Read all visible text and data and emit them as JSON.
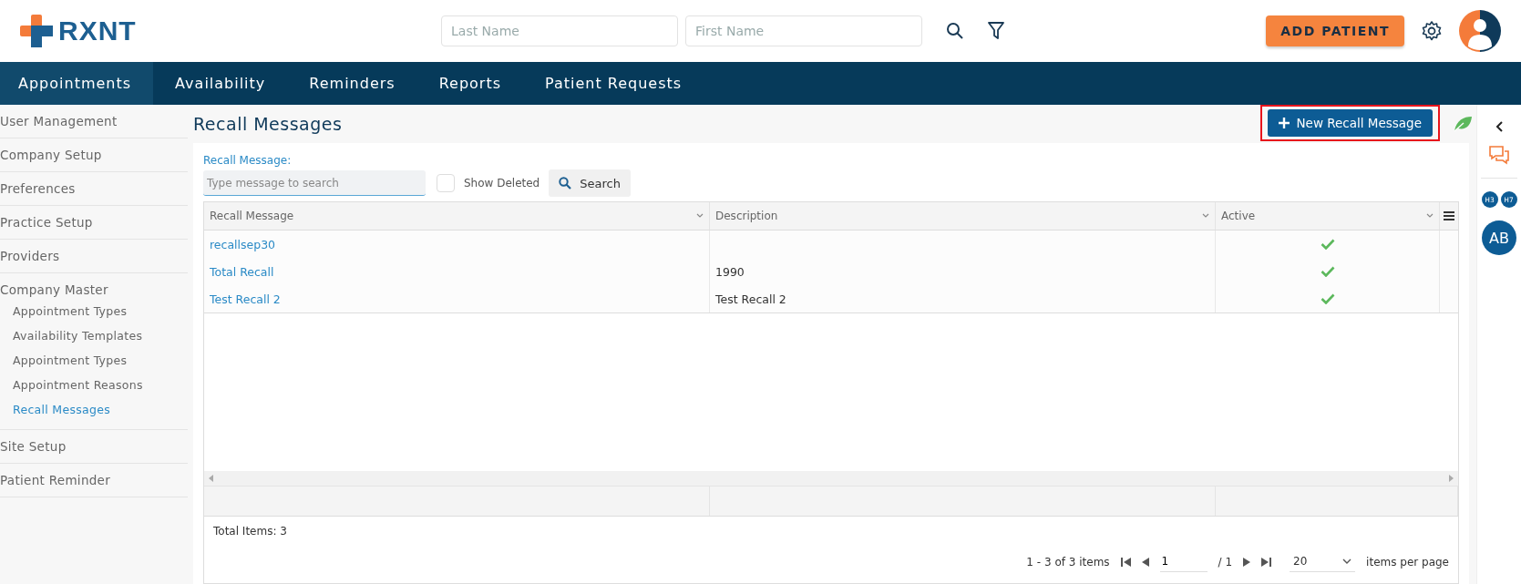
{
  "header": {
    "logo_text": "RXNT",
    "last_name": {
      "placeholder": "Last Name"
    },
    "first_name": {
      "placeholder": "First Name"
    },
    "add_patient": "ADD PATIENT"
  },
  "nav": [
    {
      "label": "Appointments",
      "selected": true
    },
    {
      "label": "Availability",
      "selected": false
    },
    {
      "label": "Reminders",
      "selected": false
    },
    {
      "label": "Reports",
      "selected": false
    },
    {
      "label": "Patient Requests",
      "selected": false
    }
  ],
  "sidebar": [
    {
      "label": "User Management",
      "selected": false
    },
    {
      "label": "Company Setup",
      "selected": false
    },
    {
      "label": "Preferences",
      "selected": false
    },
    {
      "label": "Practice Setup",
      "selected": false
    },
    {
      "label": "Providers",
      "selected": false
    },
    {
      "label": "Company Master",
      "selected": false,
      "children": [
        {
          "label": "Appointment Types",
          "selected": false
        },
        {
          "label": "Availability Templates",
          "selected": false
        },
        {
          "label": "Appointment Types",
          "selected": false
        },
        {
          "label": "Appointment Reasons",
          "selected": false
        },
        {
          "label": "Recall Messages",
          "selected": true
        }
      ]
    },
    {
      "label": "Site Setup",
      "selected": false
    },
    {
      "label": "Patient Reminder",
      "selected": false
    }
  ],
  "page": {
    "title": "Recall Messages",
    "new_button": "New Recall Message",
    "new_button_highlighted": true
  },
  "filter": {
    "label": "Recall Message:",
    "placeholder": "Type message to search",
    "show_deleted": {
      "label": "Show Deleted",
      "checked": false
    },
    "search_button": "Search"
  },
  "table": {
    "columns": [
      "Recall Message",
      "Description",
      "Active"
    ],
    "rows": [
      {
        "message": "recallsep30",
        "description": "",
        "active": true
      },
      {
        "message": "Total Recall",
        "description": "1990",
        "active": true
      },
      {
        "message": "Test Recall 2",
        "description": "Test Recall 2",
        "active": true
      }
    ],
    "total": "Total Items: 3"
  },
  "pager": {
    "range": "1 - 3 of 3 items",
    "page": "1",
    "of": "/ 1",
    "page_size": "20",
    "per_page": "items per page"
  },
  "rail": {
    "badges": [
      "H3",
      "H7"
    ],
    "avatar": "AB"
  }
}
